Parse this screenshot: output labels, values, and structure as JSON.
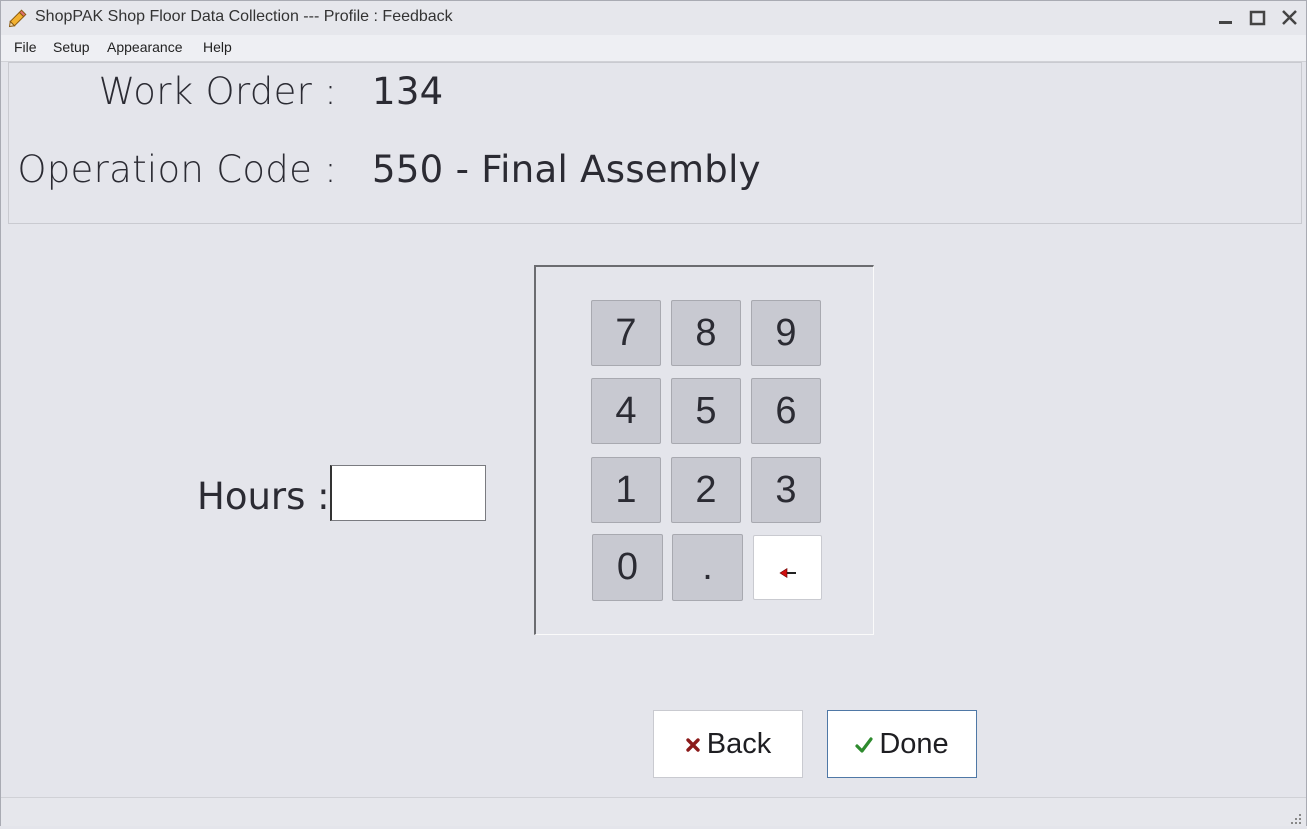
{
  "window": {
    "title": "ShopPAK Shop Floor Data Collection --- Profile : Feedback",
    "icon": "pencil-icon",
    "controls": [
      "minimize-icon",
      "maximize-icon",
      "close-icon"
    ]
  },
  "menu": {
    "items": [
      "File",
      "Setup",
      "Appearance",
      "Help"
    ]
  },
  "header": {
    "work_order_label": "Work Order :",
    "work_order_value": "134",
    "operation_label": "Operation Code :",
    "operation_value": "550 - Final Assembly"
  },
  "form": {
    "hours_label": "Hours :",
    "hours_value": ""
  },
  "keypad": {
    "keys": [
      "7",
      "8",
      "9",
      "4",
      "5",
      "6",
      "1",
      "2",
      "3",
      "0",
      ".",
      ""
    ],
    "backspace_icon": "backspace-arrow-icon"
  },
  "actions": {
    "back_label": "Back",
    "done_label": "Done"
  },
  "colors": {
    "background": "#e4e5eb",
    "key_fill": "#c8c9d1",
    "back_icon": "#8b1a1a",
    "done_icon": "#2e8b2e",
    "backspace_icon": "#d01010"
  }
}
